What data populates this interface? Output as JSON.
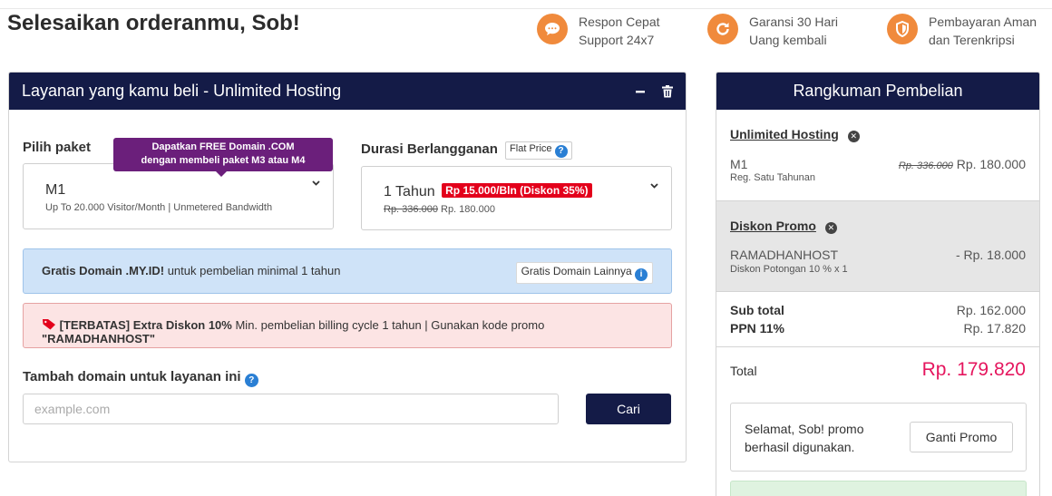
{
  "page": {
    "title": "Selesaikan orderanmu, Sob!"
  },
  "features": [
    {
      "icon": "chat-icon",
      "line1": "Respon Cepat",
      "line2": "Support 24x7"
    },
    {
      "icon": "refresh-icon",
      "line1": "Garansi 30 Hari",
      "line2": "Uang kembali"
    },
    {
      "icon": "shield-icon",
      "line1": "Pembayaran Aman",
      "line2": "dan Terenkripsi"
    }
  ],
  "service": {
    "header": "Layanan yang kamu beli - Unlimited Hosting",
    "package_label": "Pilih paket",
    "tooltip_line1": "Dapatkan FREE Domain .COM",
    "tooltip_line2": "dengan membeli paket M3 atau M4",
    "package_name": "M1",
    "package_desc": "Up To 20.000 Visitor/Month | Unmetered Bandwidth",
    "duration_label": "Durasi Berlangganan",
    "flat_price": "Flat Price",
    "duration_value": "1 Tahun",
    "duration_badge": "Rp 15.000/Bln (Diskon 35%)",
    "duration_old_price": "Rp. 336.000",
    "duration_price": "Rp. 180.000",
    "info_bold": "Gratis Domain .MY.ID!",
    "info_rest": " untuk pembelian minimal 1 tahun",
    "info_button": "Gratis Domain Lainnya",
    "promo_bold": "[TERBATAS] Extra Diskon 10%",
    "promo_rest": " Min. pembelian billing cycle 1 tahun | Gunakan kode promo ",
    "promo_code": "\"RAMADHANHOST\"",
    "domain_label": "Tambah domain untuk layanan ini",
    "domain_placeholder": "example.com",
    "search_button": "Cari"
  },
  "summary": {
    "header": "Rangkuman Pembelian",
    "product_title": "Unlimited Hosting",
    "product_name": "M1",
    "product_old_price": "Rp. 336.000",
    "product_price": "Rp. 180.000",
    "product_desc": "Reg. Satu Tahunan",
    "promo_title": "Diskon Promo",
    "promo_code": "RAMADHANHOST",
    "promo_amount": "- Rp. 18.000",
    "promo_desc": "Diskon Potongan 10 % x 1",
    "subtotal_label": "Sub total",
    "subtotal_value": "Rp. 162.000",
    "tax_label": "PPN 11%",
    "tax_value": "Rp. 17.820",
    "total_label": "Total",
    "total_value": "Rp. 179.820",
    "promo_msg_line1": "Selamat, Sob! promo",
    "promo_msg_line2": "berhasil digunakan.",
    "change_promo_button": "Ganti Promo"
  },
  "colors": {
    "navy": "#141b47",
    "orange": "#f08a3c",
    "total_pink": "#e5165e",
    "badge_red": "#e3001b",
    "tooltip_purple": "#6b1f7b"
  }
}
